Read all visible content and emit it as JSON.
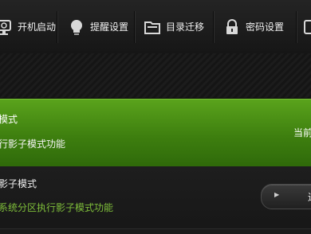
{
  "toolbar": {
    "tabs": [
      {
        "label": "开机启动",
        "icon": "monitor-power-icon"
      },
      {
        "label": "提醒设置",
        "icon": "lightbulb-icon"
      },
      {
        "label": "目录迁移",
        "icon": "folder-icon"
      },
      {
        "label": "密码设置",
        "icon": "lock-icon"
      }
    ]
  },
  "green_panel": {
    "title_partial": "模式",
    "desc_partial": "行影子模式功能",
    "status_partial": "当前"
  },
  "dark_panel": {
    "title_partial": "影子模式",
    "desc_partial": "系统分区执行影子模式功能",
    "button_partial": "进"
  },
  "colors": {
    "accent_green": "#4a9216",
    "desc_green": "#7fbf3a"
  }
}
